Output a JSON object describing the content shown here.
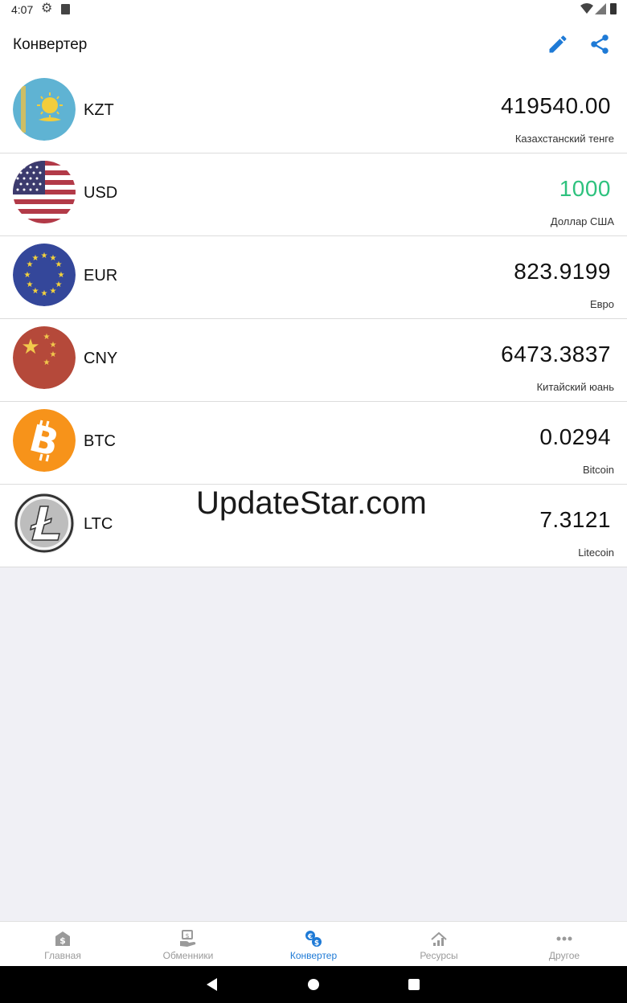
{
  "status_bar": {
    "time": "4:07"
  },
  "app_bar": {
    "title": "Конвертер"
  },
  "currencies": [
    {
      "code": "KZT",
      "value": "419540.00",
      "name": "Казахстанский тенге",
      "active": false
    },
    {
      "code": "USD",
      "value": "1000",
      "name": "Доллар США",
      "active": true
    },
    {
      "code": "EUR",
      "value": "823.9199",
      "name": "Евро",
      "active": false
    },
    {
      "code": "CNY",
      "value": "6473.3837",
      "name": "Китайский юань",
      "active": false
    },
    {
      "code": "BTC",
      "value": "0.0294",
      "name": "Bitcoin",
      "active": false
    },
    {
      "code": "LTC",
      "value": "7.3121",
      "name": "Litecoin",
      "active": false
    }
  ],
  "watermark": "UpdateStar.com",
  "bottom_nav": [
    {
      "label": "Главная",
      "icon": "home-dollar-icon",
      "active": false
    },
    {
      "label": "Обменники",
      "icon": "exchange-hand-icon",
      "active": false
    },
    {
      "label": "Конвертер",
      "icon": "converter-icon",
      "active": true
    },
    {
      "label": "Ресурсы",
      "icon": "resources-icon",
      "active": false
    },
    {
      "label": "Другое",
      "icon": "more-dots-icon",
      "active": false
    }
  ],
  "colors": {
    "accent": "#1e7ad6",
    "active_value": "#2ec27e",
    "background": "#f0f0f5"
  }
}
